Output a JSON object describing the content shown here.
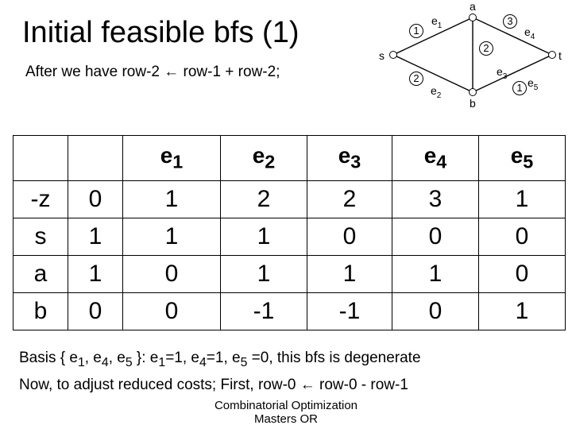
{
  "title": "Initial feasible bfs (1)",
  "bullet": "After we have row-2 ← row-1 + row-2;",
  "graph": {
    "nodes": {
      "s": "s",
      "a": "a",
      "b": "b",
      "t": "t"
    },
    "edge_labels": {
      "e1": "e",
      "e2": "e",
      "e3": "e",
      "e4": "e",
      "e5": "e"
    },
    "edge_subs": {
      "e1": "1",
      "e2": "2",
      "e3": "3",
      "e4": "4",
      "e5": "5"
    },
    "weights": {
      "w1": "1",
      "w2": "2",
      "w3": "2",
      "w4": "3",
      "w5": "1"
    }
  },
  "table": {
    "headers": {
      "e1": "e",
      "e2": "e",
      "e3": "e",
      "e4": "e",
      "e5": "e"
    },
    "subs": {
      "e1": "1",
      "e2": "2",
      "e3": "3",
      "e4": "4",
      "e5": "5"
    },
    "rows": [
      {
        "label": "-z",
        "c1": "0",
        "e1": "1",
        "e2": "2",
        "e3": "2",
        "e4": "3",
        "e5": "1"
      },
      {
        "label": "s",
        "c1": "1",
        "e1": "1",
        "e2": "1",
        "e3": "0",
        "e4": "0",
        "e5": "0"
      },
      {
        "label": "a",
        "c1": "1",
        "e1": "0",
        "e2": "1",
        "e3": "1",
        "e4": "1",
        "e5": "0"
      },
      {
        "label": "b",
        "c1": "0",
        "e1": "0",
        "e2": "-1",
        "e3": "-1",
        "e4": "0",
        "e5": "1"
      }
    ]
  },
  "bottom": {
    "basis_prefix": "Basis { e",
    "basis_mid1": ", e",
    "basis_mid2": ", e",
    "basis_close": " }:   e",
    "basis_eq1": "=1, e",
    "basis_eq2": "=1, e",
    "basis_tail": " =0, this bfs is degenerate",
    "basis_s1": "1",
    "basis_s4": "4",
    "basis_s5": "5",
    "basis_v1": "1",
    "basis_v4": "4",
    "basis_v5": "5",
    "adjust": "Now, to adjust reduced costs; First, row-0 ← row-0 - row-1"
  },
  "footer": {
    "l1": "Combinatorial Optimization",
    "l2": "Masters OR"
  },
  "chart_data": {
    "type": "table",
    "title": "Simplex tableau after row-2 ← row-1 + row-2",
    "columns": [
      "",
      "",
      "e1",
      "e2",
      "e3",
      "e4",
      "e5"
    ],
    "rows": [
      [
        "-z",
        0,
        1,
        2,
        2,
        3,
        1
      ],
      [
        "s",
        1,
        1,
        1,
        0,
        0,
        0
      ],
      [
        "a",
        1,
        0,
        1,
        1,
        1,
        0
      ],
      [
        "b",
        0,
        0,
        -1,
        -1,
        0,
        1
      ]
    ],
    "graph": {
      "nodes": [
        "s",
        "a",
        "b",
        "t"
      ],
      "edges": [
        {
          "name": "e1",
          "from": "s",
          "to": "a",
          "cost": 1
        },
        {
          "name": "e2",
          "from": "s",
          "to": "b",
          "cost": 2
        },
        {
          "name": "e3",
          "from": "a",
          "to": "b",
          "cost": 2
        },
        {
          "name": "e4",
          "from": "a",
          "to": "t",
          "cost": 3
        },
        {
          "name": "e5",
          "from": "b",
          "to": "t",
          "cost": 1
        }
      ]
    },
    "basis": [
      "e1",
      "e4",
      "e5"
    ],
    "basis_values": {
      "e1": 1,
      "e4": 1,
      "e5": 0
    },
    "degenerate": true,
    "next_step": "row-0 ← row-0 - row-1"
  }
}
